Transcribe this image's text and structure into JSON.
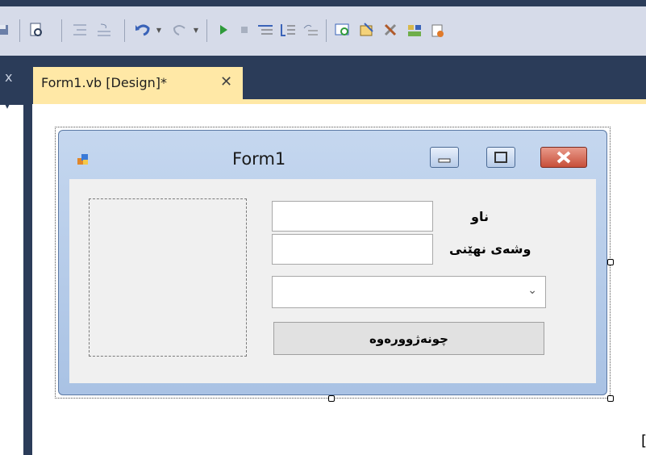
{
  "toolbar": {
    "icons": [
      "save-all-icon",
      "find-icon",
      "comment-icon",
      "uncomment-icon",
      "undo-icon",
      "redo-icon",
      "start-debug-icon",
      "stop-icon",
      "step-into-icon",
      "step-over-icon",
      "step-out-icon",
      "solution-explorer-icon",
      "properties-icon",
      "toolbox-icon",
      "object-browser-icon",
      "extension-icon"
    ]
  },
  "tab": {
    "label": "Form1.vb [Design]*",
    "close_glyph": "✕"
  },
  "left_panel": {
    "close_glyph": "x"
  },
  "form": {
    "title": "Form1",
    "labels": {
      "name": "ناو",
      "password": "وشەی نهێنی"
    },
    "textboxes": {
      "name_value": "",
      "password_value": ""
    },
    "combo": {
      "value": "",
      "arrow_glyph": "⌄"
    },
    "button_label": "چونەژوورەوە"
  },
  "colors": {
    "tab_active": "#ffe8a6",
    "ide_dark": "#2b3c59",
    "form_close": "#c74f3a"
  }
}
